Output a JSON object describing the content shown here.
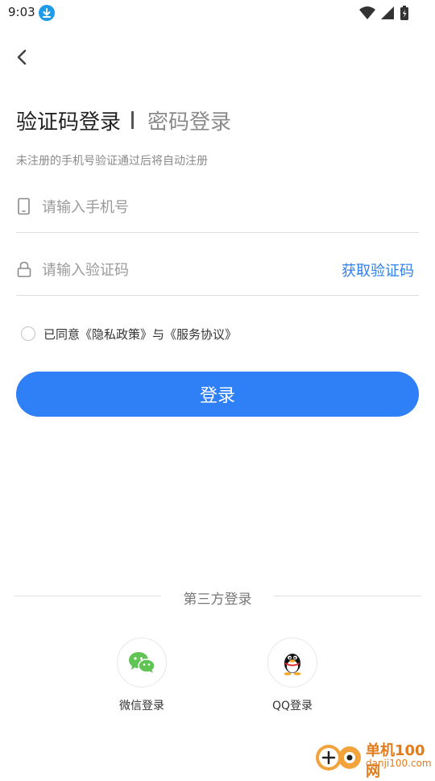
{
  "status_bar": {
    "time": "9:03",
    "icons": [
      "download-icon",
      "wifi-icon",
      "signal-icon",
      "battery-icon"
    ]
  },
  "header": {
    "back_icon": "back-arrow-icon"
  },
  "tabs": {
    "sms_login": "验证码登录",
    "password_login": "密码登录"
  },
  "hint": "未注册的手机号验证通过后将自动注册",
  "phone": {
    "placeholder": "请输入手机号",
    "value": ""
  },
  "code": {
    "placeholder": "请输入验证码",
    "value": "",
    "get_code_label": "获取验证码"
  },
  "agreement": {
    "checked": false,
    "prefix": "已同意",
    "privacy": "《隐私政策》",
    "and": "与",
    "service": "《服务协议》"
  },
  "login_button": "登录",
  "third_party": {
    "title": "第三方登录",
    "wechat_label": "微信登录",
    "qq_label": "QQ登录"
  },
  "watermark": {
    "cn": "单机100网",
    "en": "danji100.com"
  },
  "colors": {
    "accent": "#2f7ff7",
    "link": "#2f7ff0",
    "wechat": "#5fc454",
    "watermark": "#e27b1a"
  }
}
